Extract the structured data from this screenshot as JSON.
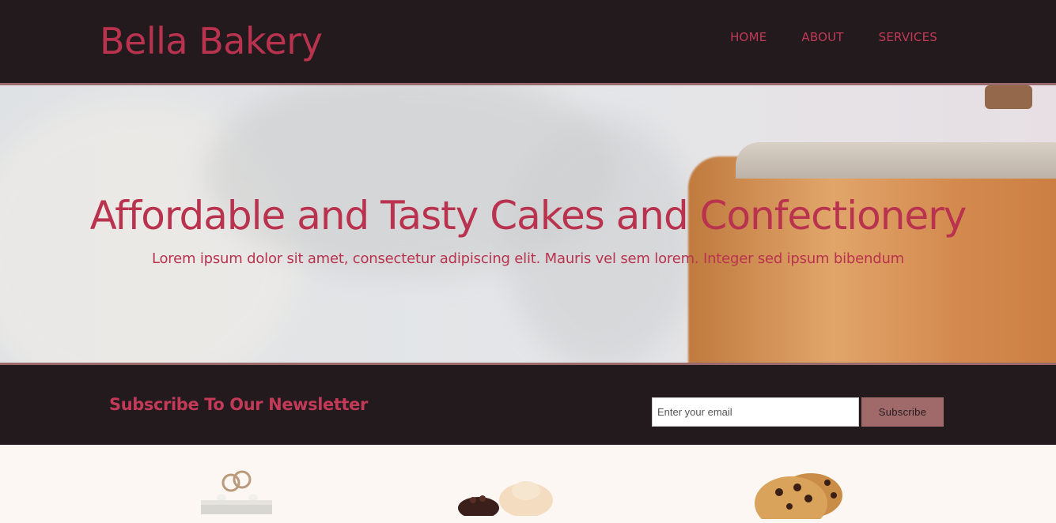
{
  "header": {
    "logo": "Bella Bakery",
    "nav": [
      {
        "label": "HOME"
      },
      {
        "label": "ABOUT"
      },
      {
        "label": "SERVICES"
      }
    ]
  },
  "hero": {
    "title": "Affordable and Tasty Cakes and Confectionery",
    "subtitle": "Lorem ipsum dolor sit amet, consectetur adipiscing elit. Mauris vel sem lorem. Integer sed ipsum bibendum"
  },
  "newsletter": {
    "title": "Subscribe To Our Newsletter",
    "email_placeholder": "Enter your email",
    "button_label": "Subscribe"
  },
  "products": [
    {
      "icon": "wedding-cake-icon"
    },
    {
      "icon": "cupcakes-icon"
    },
    {
      "icon": "cookies-icon"
    }
  ],
  "colors": {
    "header_bg": "#231a1d",
    "accent": "#b9334f",
    "button_bg": "#a0696a",
    "page_bg": "#fdf7f3"
  }
}
